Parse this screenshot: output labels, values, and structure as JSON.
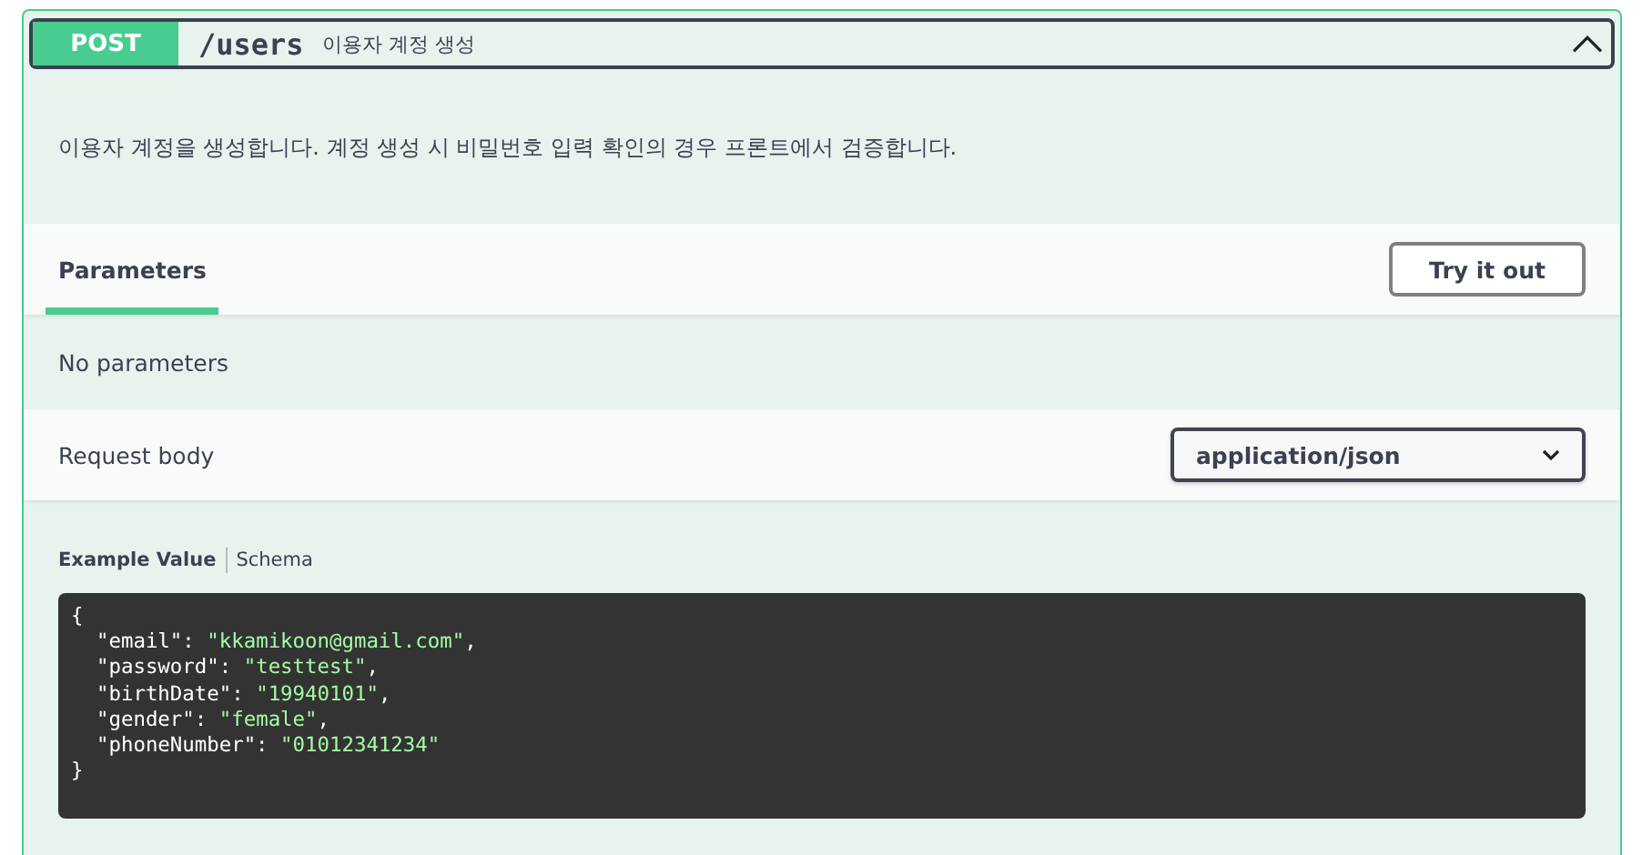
{
  "operation": {
    "method": "POST",
    "path": "/users",
    "summary": "이용자 계정 생성",
    "expanded": true
  },
  "description": "이용자 계정을 생성합니다. 계정 생성 시 비밀번호 입력 확인의 경우 프론트에서 검증합니다.",
  "section_tabs": [
    {
      "label": "Parameters",
      "selected": true
    }
  ],
  "try_button": "Try it out",
  "parameters_message": "No parameters",
  "request_body": {
    "label": "Request body",
    "content_type": "application/json"
  },
  "example_tabs": [
    {
      "label": "Example Value",
      "selected": true
    },
    {
      "label": "Schema",
      "selected": false
    }
  ],
  "code": {
    "open": "{",
    "close": "}",
    "lines": [
      {
        "key": "\"email\":",
        "value": "\"kkamikoon@gmail.com\"",
        "punct": ","
      },
      {
        "key": "\"password\":",
        "value": "\"testtest\"",
        "punct": ","
      },
      {
        "key": "\"birthDate\":",
        "value": "\"19940101\"",
        "punct": ","
      },
      {
        "key": "\"gender\":",
        "value": "\"female\"",
        "punct": ","
      },
      {
        "key": "\"phoneNumber\":",
        "value": "\"01012341234\""
      }
    ]
  }
}
